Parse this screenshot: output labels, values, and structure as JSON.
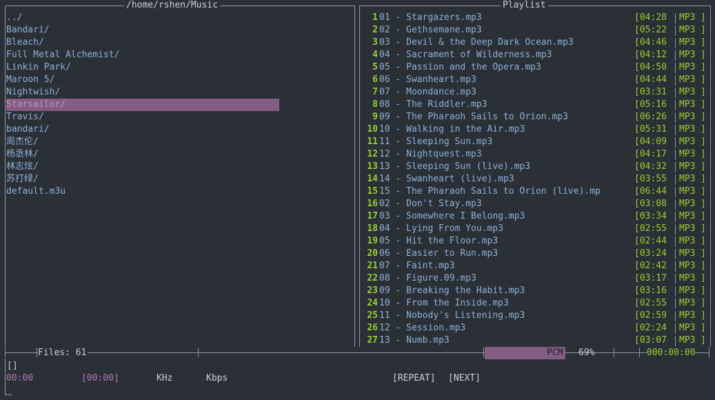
{
  "browser": {
    "path": "/home/rshen/Music",
    "items": [
      {
        "name": "../",
        "selected": false
      },
      {
        "name": "Bandari/",
        "selected": false
      },
      {
        "name": "Bleach/",
        "selected": false
      },
      {
        "name": "Full Metal Alchemist/",
        "selected": false
      },
      {
        "name": "Linkin Park/",
        "selected": false
      },
      {
        "name": "Maroon 5/",
        "selected": false
      },
      {
        "name": "Nightwish/",
        "selected": false
      },
      {
        "name": "Starsailor/",
        "selected": true
      },
      {
        "name": "Travis/",
        "selected": false
      },
      {
        "name": "bandari/",
        "selected": false
      },
      {
        "name": "周杰伦/",
        "selected": false
      },
      {
        "name": "杨丞林/",
        "selected": false
      },
      {
        "name": "林志炫/",
        "selected": false
      },
      {
        "name": "苏打绿/",
        "selected": false
      },
      {
        "name": "default.m3u",
        "selected": false
      }
    ],
    "files_label": "Files: 61"
  },
  "playlist": {
    "title": "Playlist",
    "tracks": [
      {
        "num": "1",
        "title": "01 - Stargazers.mp3",
        "time": "[04:28",
        "fmt": "MP3",
        "end": "]"
      },
      {
        "num": "2",
        "title": "02 - Gethsemane.mp3",
        "time": "[05:22",
        "fmt": "MP3",
        "end": "]"
      },
      {
        "num": "3",
        "title": "03 - Devil & the Deep Dark Ocean.mp3",
        "time": "[04:46",
        "fmt": "MP3",
        "end": "]"
      },
      {
        "num": "4",
        "title": "04 - Sacrament of Wilderness.mp3",
        "time": "[04:12",
        "fmt": "MP3",
        "end": "]"
      },
      {
        "num": "5",
        "title": "05 - Passion and the Opera.mp3",
        "time": "[04:50",
        "fmt": "MP3",
        "end": "]"
      },
      {
        "num": "6",
        "title": "06 - Swanheart.mp3",
        "time": "[04:44",
        "fmt": "MP3",
        "end": "]"
      },
      {
        "num": "7",
        "title": "07 - Moondance.mp3",
        "time": "[03:31",
        "fmt": "MP3",
        "end": "]"
      },
      {
        "num": "8",
        "title": "08 - The Riddler.mp3",
        "time": "[05:16",
        "fmt": "MP3",
        "end": "]"
      },
      {
        "num": "9",
        "title": "09 - The Pharaoh Sails to Orion.mp3",
        "time": "[06:26",
        "fmt": "MP3",
        "end": "]"
      },
      {
        "num": "10",
        "title": "10 - Walking in the Air.mp3",
        "time": "[05:31",
        "fmt": "MP3",
        "end": "]"
      },
      {
        "num": "11",
        "title": "11 - Sleeping Sun.mp3",
        "time": "[04:09",
        "fmt": "MP3",
        "end": "]"
      },
      {
        "num": "12",
        "title": "12 - Nightquest.mp3",
        "time": "[04:17",
        "fmt": "MP3",
        "end": "]"
      },
      {
        "num": "13",
        "title": "13 - Sleeping Sun (live).mp3",
        "time": "[04:32",
        "fmt": "MP3",
        "end": "]"
      },
      {
        "num": "14",
        "title": "14 - Swanheart (live).mp3",
        "time": "[03:55",
        "fmt": "MP3",
        "end": "]"
      },
      {
        "num": "15",
        "title": "15 - The Pharaoh Sails to Orion (live).mp",
        "time": "[06:44",
        "fmt": "MP3",
        "end": "]"
      },
      {
        "num": "16",
        "title": "02 - Don't Stay.mp3",
        "time": "[03:08",
        "fmt": "MP3",
        "end": "]"
      },
      {
        "num": "17",
        "title": "03 - Somewhere I Belong.mp3",
        "time": "[03:34",
        "fmt": "MP3",
        "end": "]"
      },
      {
        "num": "18",
        "title": "04 - Lying From You.mp3",
        "time": "[02:55",
        "fmt": "MP3",
        "end": "]"
      },
      {
        "num": "19",
        "title": "05 - Hit the Floor.mp3",
        "time": "[02:44",
        "fmt": "MP3",
        "end": "]"
      },
      {
        "num": "20",
        "title": "06 - Easier to Run.mp3",
        "time": "[03:24",
        "fmt": "MP3",
        "end": "]"
      },
      {
        "num": "21",
        "title": "07 - Faint.mp3",
        "time": "[02:42",
        "fmt": "MP3",
        "end": "]"
      },
      {
        "num": "22",
        "title": "08 - Figure.09.mp3",
        "time": "[03:17",
        "fmt": "MP3",
        "end": "]"
      },
      {
        "num": "23",
        "title": "09 - Breaking the Habit.mp3",
        "time": "[03:16",
        "fmt": "MP3",
        "end": "]"
      },
      {
        "num": "24",
        "title": "10 - From the Inside.mp3",
        "time": "[02:55",
        "fmt": "MP3",
        "end": "]"
      },
      {
        "num": "25",
        "title": "11 - Nobody's Listening.mp3",
        "time": "[02:59",
        "fmt": "MP3",
        "end": "]"
      },
      {
        "num": "26",
        "title": "12 - Session.mp3",
        "time": "[02:24",
        "fmt": "MP3",
        "end": "]"
      },
      {
        "num": "27",
        "title": "13 - Numb.mp3",
        "time": "[03:07",
        "fmt": "MP3",
        "end": "]"
      }
    ]
  },
  "mixer": {
    "label": "PCM",
    "percent_text": "69%",
    "level": 0.69
  },
  "total_time": "000:00:00",
  "status": {
    "song_title": "[]",
    "elapsed": "00:00",
    "duration": "[00:00]",
    "khz": "KHz",
    "kbps": "Kbps",
    "repeat": "[REPEAT]",
    "next": "[NEXT]"
  },
  "colors": {
    "background": "#2b3036",
    "text": "#8db1d8",
    "accent_green": "#9acd32",
    "selection": "#845c84",
    "border": "#8b98a8"
  }
}
